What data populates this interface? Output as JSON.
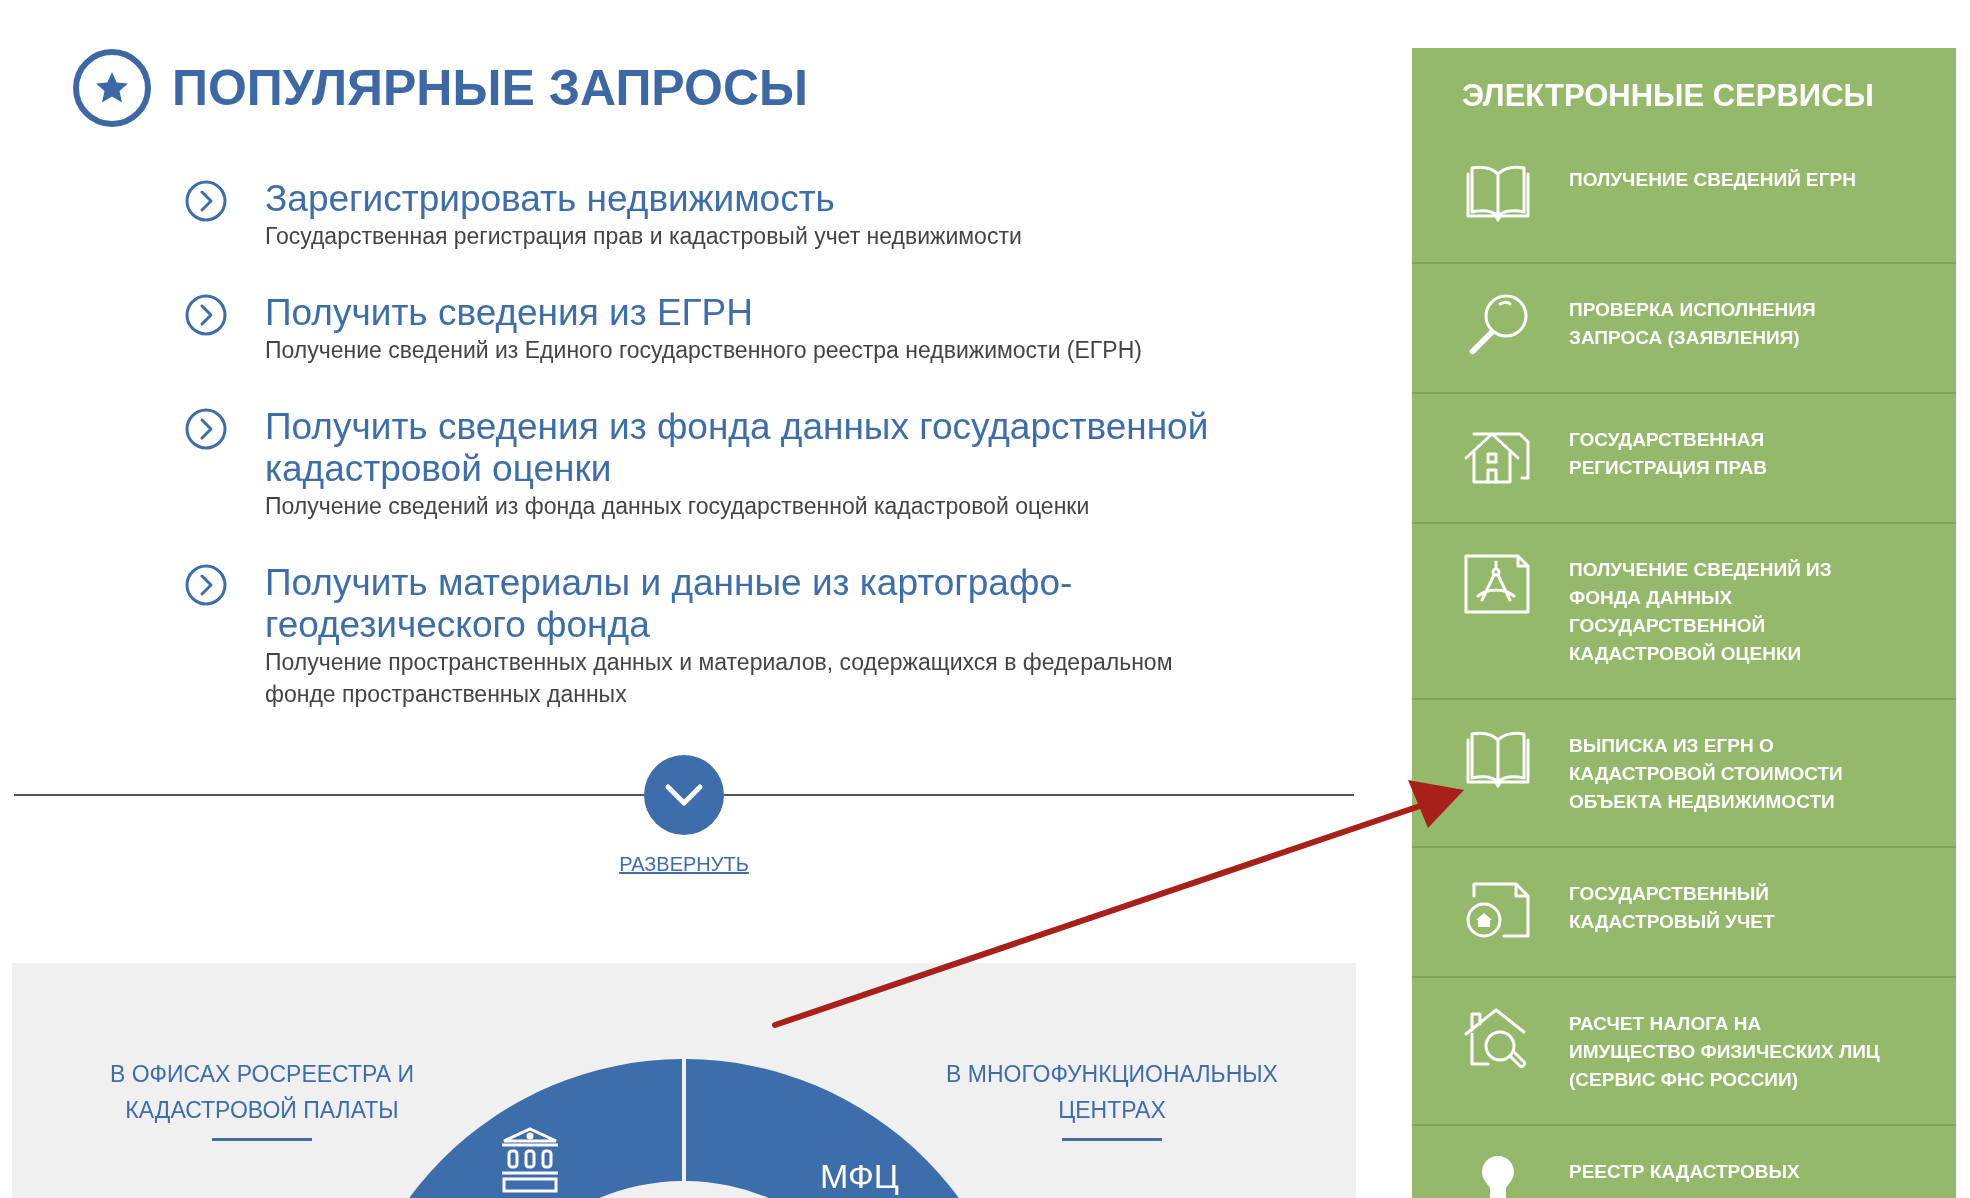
{
  "popular": {
    "title": "ПОПУЛЯРНЫЕ ЗАПРОСЫ",
    "items": [
      {
        "title": "Зарегистрировать недвижимость",
        "description": "Государственная регистрация прав и кадастровый учет недвижимости"
      },
      {
        "title": "Получить сведения из ЕГРН",
        "description": "Получение сведений из Единого государственного реестра недвижимости (ЕГРН)"
      },
      {
        "title": "Получить сведения из фонда данных государственной\nкадастровой оценки",
        "description": "Получение сведений из фонда данных государственной кадастровой оценки"
      },
      {
        "title": "Получить материалы и данные из картографо-\nгеодезического фонда",
        "description": "Получение пространственных данных и материалов, содержащихся в федеральном\nфонде пространственных данных"
      }
    ],
    "expand": "РАЗВЕРНУТЬ"
  },
  "channels": {
    "left_caption": "В ОФИСАХ РОСРЕЕСТРА И\nКАДАСТРОВОЙ ПАЛАТЫ",
    "right_caption": "В МНОГОФУНКЦИОНАЛЬНЫХ\nЦЕНТРАХ",
    "segment_label": "МФЦ"
  },
  "services": {
    "title": "ЭЛЕКТРОННЫЕ СЕРВИСЫ",
    "items": [
      {
        "label": "ПОЛУЧЕНИЕ СВЕДЕНИЙ ЕГРН"
      },
      {
        "label": "ПРОВЕРКА ИСПОЛНЕНИЯ\nЗАПРОСА (ЗАЯВЛЕНИЯ)"
      },
      {
        "label": "ГОСУДАРСТВЕННАЯ\nРЕГИСТРАЦИЯ ПРАВ"
      },
      {
        "label": "ПОЛУЧЕНИЕ СВЕДЕНИЙ ИЗ\nФОНДА ДАННЫХ\nГОСУДАРСТВЕННОЙ\nКАДАСТРОВОЙ ОЦЕНКИ"
      },
      {
        "label": "ВЫПИСКА ИЗ ЕГРН О\nКАДАСТРОВОЙ СТОИМОСТИ\nОБЪЕКТА НЕДВИЖИМОСТИ"
      },
      {
        "label": "ГОСУДАРСТВЕННЫЙ\nКАДАСТРОВЫЙ УЧЕТ"
      },
      {
        "label": "РАСЧЕТ НАЛОГА НА\nИМУЩЕСТВО ФИЗИЧЕСКИХ ЛИЦ\n(СЕРВИС ФНС РОССИИ)"
      },
      {
        "label": "РЕЕСТР КАДАСТРОВЫХ"
      }
    ]
  }
}
